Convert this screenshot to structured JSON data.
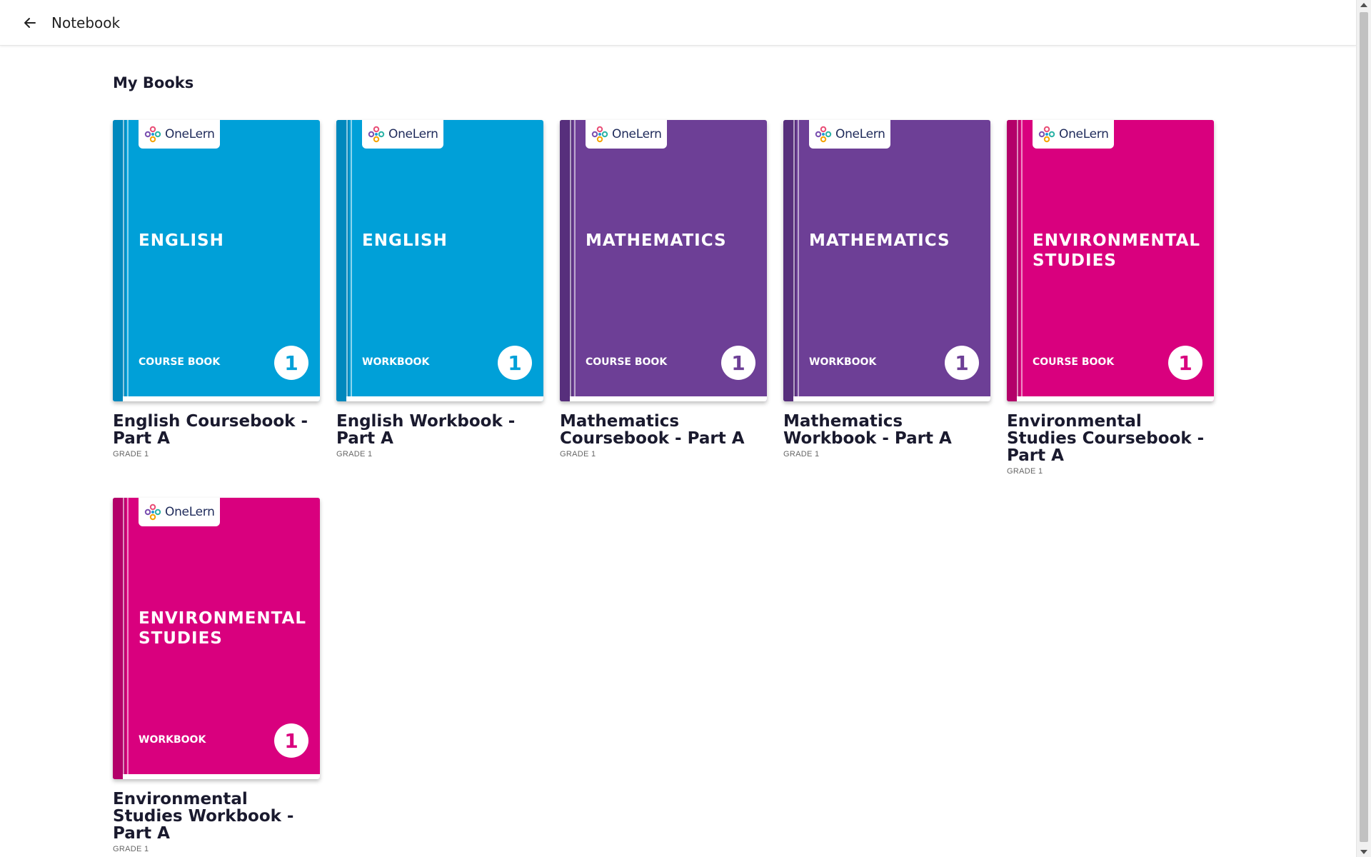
{
  "header": {
    "back_icon": "arrow-left-icon",
    "title": "Notebook"
  },
  "section": {
    "title": "My Books"
  },
  "brand": {
    "logo_text": "OneLern",
    "logo_icon": "onelern-flower-logo"
  },
  "colors": {
    "english": "#00a0d8",
    "english_spine": "#0088bd",
    "mathematics": "#6d3f96",
    "mathematics_spine": "#572f7c",
    "evs": "#d9007e",
    "evs_spine": "#b30069"
  },
  "books": [
    {
      "subject": "ENGLISH",
      "type": "COURSE BOOK",
      "grade_number": "1",
      "title": "English Coursebook - Part A",
      "grade": "GRADE 1",
      "color": "#00a0d8",
      "spine": "#0088bd"
    },
    {
      "subject": "ENGLISH",
      "type": "WORKBOOK",
      "grade_number": "1",
      "title": "English Workbook - Part A",
      "grade": "GRADE 1",
      "color": "#00a0d8",
      "spine": "#0088bd"
    },
    {
      "subject": "MATHEMATICS",
      "type": "COURSE BOOK",
      "grade_number": "1",
      "title": "Mathematics Coursebook - Part A",
      "grade": "GRADE 1",
      "color": "#6d3f96",
      "spine": "#572f7c"
    },
    {
      "subject": "MATHEMATICS",
      "type": "WORKBOOK",
      "grade_number": "1",
      "title": "Mathematics Workbook - Part A",
      "grade": "GRADE 1",
      "color": "#6d3f96",
      "spine": "#572f7c"
    },
    {
      "subject": "ENVIRONMENTAL STUDIES",
      "type": "COURSE BOOK",
      "grade_number": "1",
      "title": "Environmental Studies Coursebook - Part A",
      "grade": "GRADE 1",
      "color": "#d9007e",
      "spine": "#b30069"
    },
    {
      "subject": "ENVIRONMENTAL STUDIES",
      "type": "WORKBOOK",
      "grade_number": "1",
      "title": "Environmental Studies Workbook - Part A",
      "grade": "GRADE 1",
      "color": "#d9007e",
      "spine": "#b30069"
    }
  ]
}
